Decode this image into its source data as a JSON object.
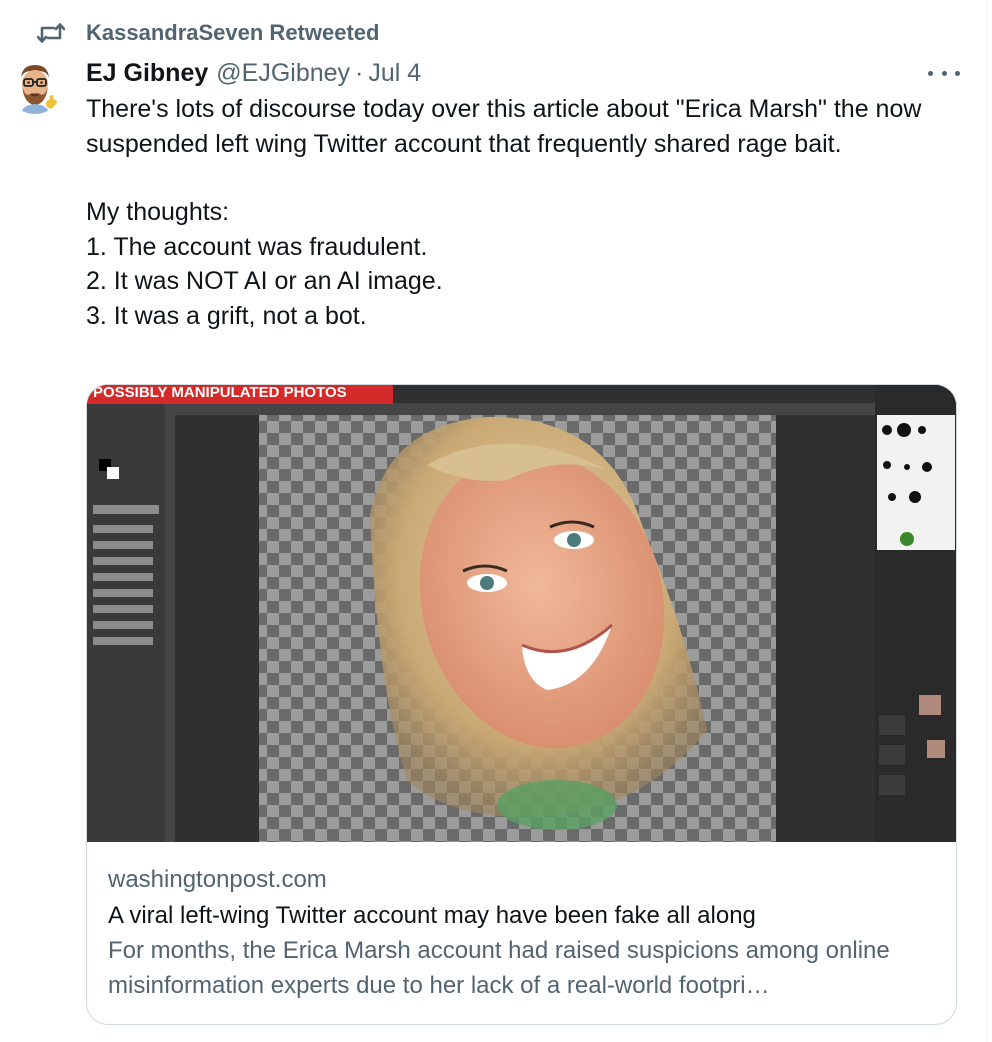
{
  "retweet": {
    "text": "KassandraSeven Retweeted"
  },
  "tweet": {
    "display_name": "EJ Gibney",
    "handle": "@EJGibney",
    "separator": "·",
    "date": "Jul 4",
    "paragraph_1": "There's lots of discourse today over this article about \"Erica Marsh\" the now suspended left wing Twitter account that frequently shared rage bait.",
    "paragraph_2": "My thoughts:",
    "list": [
      "1. The account was fraudulent.",
      "2. It was NOT AI or an AI image.",
      "3. It was a grift, not a bot."
    ]
  },
  "card": {
    "banner_text": "POSSIBLY MANIPULATED PHOTOS",
    "domain": "washingtonpost.com",
    "title": "A viral left-wing Twitter account may have been fake all along",
    "description": "For months, the Erica Marsh account had raised suspicions among online misinformation experts due to her lack of a real-world footpri…"
  },
  "icons": {
    "retweet": "retweet-icon",
    "more": "more-icon",
    "avatar": "memoji-avatar"
  },
  "colors": {
    "text_primary": "#0f1419",
    "text_secondary": "#536471",
    "card_border": "#cfd9de",
    "banner_red": "#d42a2a"
  }
}
